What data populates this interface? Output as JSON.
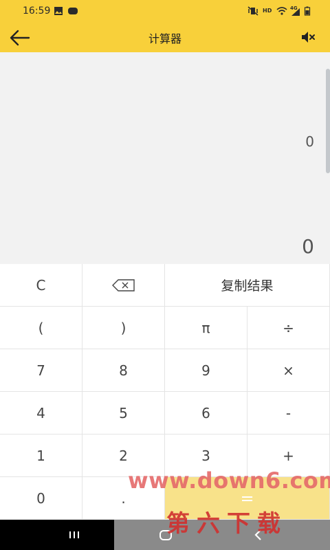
{
  "status_bar": {
    "time": "16:59",
    "left_icons": [
      "image-icon",
      "app-notification-icon"
    ],
    "right_icons": [
      "vibrate-mute-icon",
      "hd-icon",
      "wifi-icon",
      "signal-icon",
      "battery-icon"
    ],
    "hd_label": "HD",
    "network_label": "4G"
  },
  "app_bar": {
    "title": "计算器",
    "back_icon": "arrow-left-icon",
    "mute_icon": "speaker-mute-icon",
    "background": "#f8d03a"
  },
  "display": {
    "expression": "0",
    "result": "0"
  },
  "keypad": {
    "row1": {
      "clear": "C",
      "backspace_icon": "backspace-icon",
      "copy": "复制结果"
    },
    "row2": [
      "(",
      ")",
      "π",
      "÷"
    ],
    "row3": [
      "7",
      "8",
      "9",
      "×"
    ],
    "row4": [
      "4",
      "5",
      "6",
      "-"
    ],
    "row5": [
      "1",
      "2",
      "3",
      "+"
    ],
    "row6": {
      "zero": "0",
      "dot": ".",
      "equals": "="
    }
  },
  "nav_bar": {
    "icons": [
      "recent-apps-icon",
      "home-icon",
      "back-nav-icon"
    ]
  },
  "watermark": {
    "line1": "www.down6.com",
    "line2": "第六下载"
  }
}
